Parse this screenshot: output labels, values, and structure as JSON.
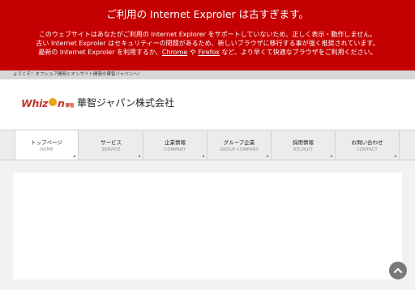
{
  "ie_notice": {
    "title": "ご利用の Internet Exproler は古すぎます。",
    "line1": "このウェブサイトはあなたがご利用の Internet Explorer をサポートしていないため、正しく表示・動作しません。",
    "line2": "古い Internet Exproler はセキュリティーの問題があるため、新しいブラウザに移行する事が強く推奨されています。",
    "line3_before": "最新の Internet Exproler を利用するか、",
    "chrome_link": "Chrome",
    "line3_middle": " や ",
    "firefox_link": "Firefox",
    "line3_after": " など、より早くて快適なブラウザをご利用ください。"
  },
  "welcome": "ようこそ！オフショア開発とオンサイト開発の華智ジャパンへ！",
  "header": {
    "logo_pre": "Whiz",
    "logo_post": "n",
    "logo_sub": "華智",
    "company_name": "華智ジャパン株式会社"
  },
  "nav": [
    {
      "ja": "トップページ",
      "en": "HOME"
    },
    {
      "ja": "サービス",
      "en": "SERVICE"
    },
    {
      "ja": "企業情報",
      "en": "COMPANY"
    },
    {
      "ja": "グループ企業",
      "en": "GROUP COMPANY"
    },
    {
      "ja": "採用情報",
      "en": "RECRUIT"
    },
    {
      "ja": "お問い合わせ",
      "en": "CONTACT"
    }
  ],
  "colors": {
    "banner": "#c40000",
    "brand_red": "#c0392b",
    "brand_orange": "#e8a317"
  },
  "icons": {
    "scroll_top": "chevron-up-icon"
  }
}
